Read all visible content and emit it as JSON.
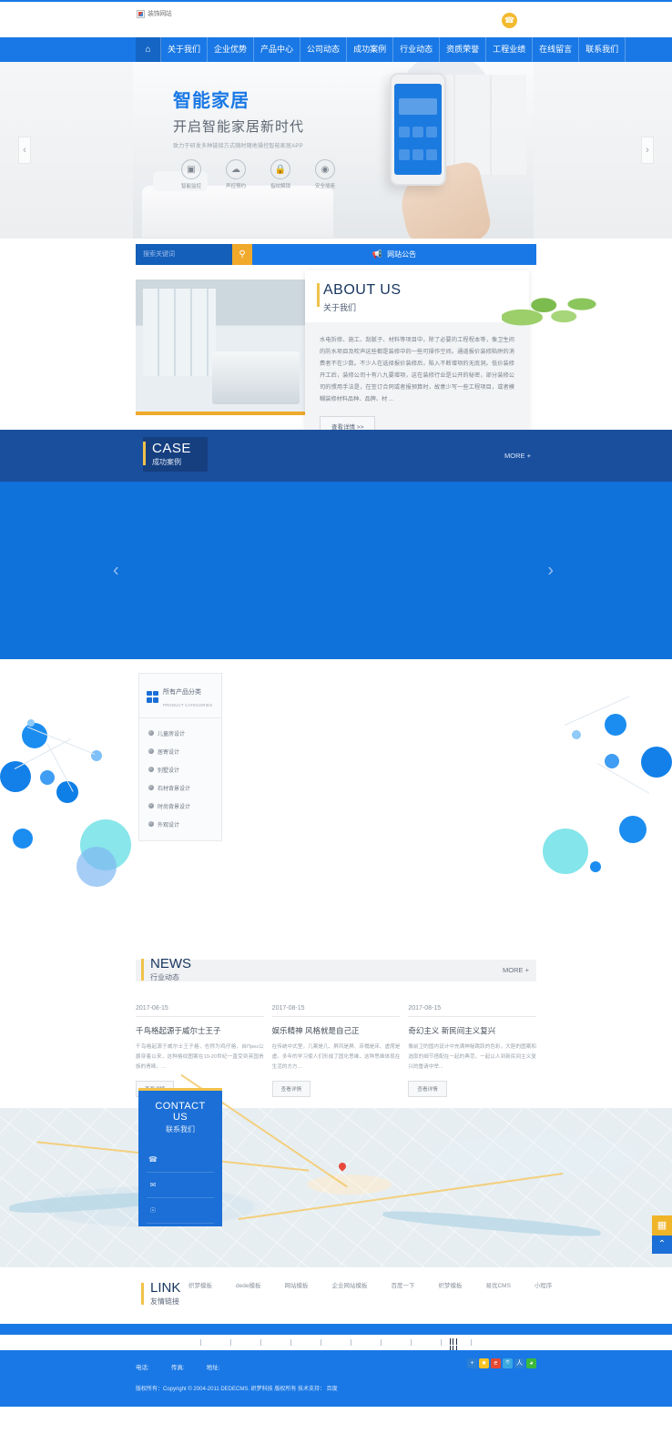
{
  "topbar": {
    "logo_alt": "装饰网站",
    "phone_icon": "phone-icon"
  },
  "nav": {
    "home_icon": "home-icon",
    "items": [
      {
        "label": "关于我们"
      },
      {
        "label": "企业优势"
      },
      {
        "label": "产品中心"
      },
      {
        "label": "公司动态"
      },
      {
        "label": "成功案例"
      },
      {
        "label": "行业动态"
      },
      {
        "label": "资质荣誉"
      },
      {
        "label": "工程业绩"
      },
      {
        "label": "在线留言"
      },
      {
        "label": "联系我们"
      }
    ]
  },
  "banner": {
    "title": "智能家居",
    "subtitle": "开启智能家居新时代",
    "description": "致力于研发多种链接方式随时随地操控智能家居APP",
    "features": [
      {
        "label": "智能监控",
        "icon": "camera-icon"
      },
      {
        "label": "声控预约",
        "icon": "voice-icon"
      },
      {
        "label": "指纹解锁",
        "icon": "lock-icon"
      },
      {
        "label": "安全插座",
        "icon": "socket-icon"
      }
    ],
    "prev_icon": "chevron-left-icon",
    "next_icon": "chevron-right-icon"
  },
  "search": {
    "placeholder": "搜索关键词",
    "value": "",
    "button_icon": "search-icon",
    "notice_icon": "megaphone-icon",
    "notice_label": "网站公告"
  },
  "about": {
    "title_en": "ABOUT US",
    "title_cn": "关于我们",
    "text": "水电拆修、施工、刮腻子、材料等项目中，除了必要的工程程本等，像卫生间的防水项目及吹声这些都是装修中的一些可操作空间。通道报价装修陷阱的消费者不在少数。不少人在选择报价装修后，陷入不断增项的无底洞。低价装修开工后，装修公司十有八九要增项，这在装修行业是公开的秘密，部分装修公司的惯用手法是，在签订合同或者报预算时，故意少写一些工程项目，或者模糊装修材料品种、品牌、材 ...",
    "button_label": "查看详情 >>"
  },
  "case": {
    "title_en": "CASE",
    "title_cn": "成功案例",
    "more_label": "MORE +",
    "prev_icon": "chevron-left-icon",
    "next_icon": "chevron-right-icon"
  },
  "products": {
    "title_cn": "所有产品分类",
    "title_en": "PRODUCT CATEGORIES",
    "logo_icon": "grid-squares-icon",
    "items": [
      {
        "label": "儿童房设计"
      },
      {
        "label": "居寄设计"
      },
      {
        "label": "别墅设计"
      },
      {
        "label": "石材背景设计"
      },
      {
        "label": "时尚背景设计"
      },
      {
        "label": "外观设计"
      }
    ]
  },
  "news": {
    "title_en": "NEWS",
    "title_cn": "行业动态",
    "more_label": "MORE +",
    "items": [
      {
        "date": "2017-08-15",
        "title": "千鸟格起源于威尔士王子",
        "summary": "千鸟格起源于威尔士王子格，也称为鸡仔格，自През公爵穿着以来，这种格纹图案在19-20世纪一直受到英国贵族的青睐。...",
        "button_label": "查看详情"
      },
      {
        "date": "2017-08-15",
        "title": "娱乐精神 风格就是自己正",
        "summary": "在传统中式里，几案是几、屏风是屏、床榻是床、虚席是虚。多年的学习使人们形成了固化思维，这种思维体现在生活的方方...",
        "button_label": "查看详情"
      },
      {
        "date": "2017-08-15",
        "title": "奇幻主义 新民间主义复兴",
        "summary": "像前卫的国内设计中充满神秘跳跃的色彩，大胆的图案和选取的细节搭配在一起的典范，一起以人到新民间主义复兴的重请中举...",
        "button_label": "查看详情"
      }
    ]
  },
  "contact": {
    "title_en": "CONTACT US",
    "title_cn": "联系我们",
    "rows": [
      {
        "icon": "phone-icon",
        "label": ""
      },
      {
        "icon": "fax-icon",
        "label": ""
      },
      {
        "icon": "location-pin-icon",
        "label": ""
      }
    ],
    "side_qr_icon": "qr-code-icon",
    "side_top_icon": "arrow-up-icon"
  },
  "link": {
    "title_en": "LINK",
    "title_cn": "友情链接",
    "items": [
      {
        "label": "织梦模板"
      },
      {
        "label": "dede模板"
      },
      {
        "label": "网站模板"
      },
      {
        "label": "企业网站模板"
      },
      {
        "label": "百度一下"
      },
      {
        "label": "织梦模板"
      },
      {
        "label": "易优CMS"
      },
      {
        "label": "小程序"
      }
    ]
  },
  "footer": {
    "phone_label": "电话:",
    "fax_label": "传真:",
    "address_label": "地址:",
    "copyright": "版权所有：Copyright © 2004-2011 DEDECMS. 织梦科技 版权所有    技术支持： 百度",
    "socials": [
      {
        "name": "share-plus-icon",
        "glyph": "+",
        "color": "#2b7fd4"
      },
      {
        "name": "favorite-star-icon",
        "glyph": "★",
        "color": "#f6c324"
      },
      {
        "name": "sina-weibo-icon",
        "glyph": "e",
        "color": "#e64a33"
      },
      {
        "name": "tencent-weibo-icon",
        "glyph": "⌾",
        "color": "#3aa8e0"
      },
      {
        "name": "qzone-icon",
        "glyph": "人",
        "color": "#2b7fd4"
      },
      {
        "name": "wechat-icon",
        "glyph": "◕",
        "color": "#3cba3c"
      }
    ]
  },
  "colors": {
    "brand_blue": "#1978e5",
    "deep_blue": "#1a4f9e",
    "case_blue": "#0f71da",
    "accent_yellow": "#f0c24a",
    "search_orange": "#f0a92a"
  }
}
